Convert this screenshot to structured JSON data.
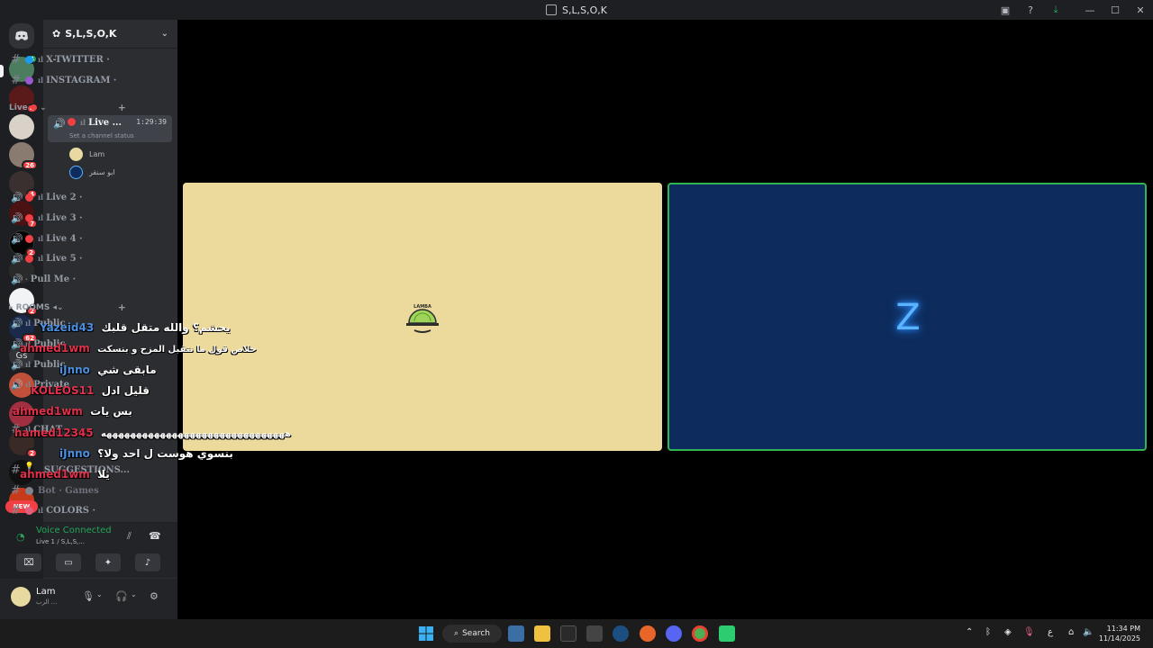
{
  "window": {
    "title": "S,L,S,O,K"
  },
  "server": {
    "name": "S,L,S,O,K"
  },
  "rail": {
    "badges": [
      "4",
      "4",
      "26",
      "4",
      "7",
      "2",
      "2",
      "2",
      "62",
      "2"
    ],
    "gs_label": "Gs",
    "new_label": "NEW"
  },
  "channels": {
    "x_twitter": "X-TWITTER",
    "instagram": "INSTAGRAM",
    "live_category": "Live",
    "live1": "Live ...",
    "live1_time": "1:29:39",
    "live1_status": "Set a channel status",
    "members": [
      "Lam",
      "ابو سنقر"
    ],
    "live2": "Live 2",
    "live3": "Live 3",
    "live4": "Live 4",
    "live5": "Live 5",
    "pull_me": "Pull Me",
    "rooms_category": "ROOMS",
    "public1": "Public",
    "public2": "Public",
    "public3": "Public",
    "private": "Private",
    "chat": "CHAT",
    "suggestions": "SUGGESTIONS...",
    "bot_games": "Bot · Games",
    "colors": "COLORS"
  },
  "voice": {
    "title": "Voice Connected",
    "subtitle": "Live 1 / S,L,S,..."
  },
  "user": {
    "name": "Lam",
    "status": "الرب ..."
  },
  "chat_overlay": [
    {
      "name": "Yazeid43",
      "msg": "يحشم؟ والله متقل قلبك",
      "name_color": "#4a90e2"
    },
    {
      "name": "ahmed1wm",
      "msg": "خلاص قول ما نتقبل المزح و بنسكت",
      "name_color": "#e0304a"
    },
    {
      "name": "iJnno",
      "msg": "مابقى شي",
      "name_color": "#4a90e2"
    },
    {
      "name": "KOLEOS11",
      "msg": "قليل ادل",
      "name_color": "#e0304a"
    },
    {
      "name": "ahmed1wm",
      "msg": "بس يات",
      "name_color": "#e0304a"
    },
    {
      "name": "hamed12345",
      "msg": "هههههههههههههههههههههههههههههههه",
      "name_color": "#e0304a"
    },
    {
      "name": "iJnno",
      "msg": "بنسوي هوست ل احد ولا؟",
      "name_color": "#4a90e2"
    },
    {
      "name": "ahmed1wm",
      "msg": "يلا",
      "name_color": "#e0304a"
    }
  ],
  "taskbar": {
    "search": "Search",
    "time": "11:34 PM",
    "date": "11/14/2025",
    "tray_lang": "ع"
  },
  "colors": {
    "live_dot": "#f23f43",
    "voice_green": "#23a55a",
    "tile_yellow": "#ecda9c",
    "tile_blue": "#0d2b5c",
    "speaking_border": "#2fb554"
  }
}
